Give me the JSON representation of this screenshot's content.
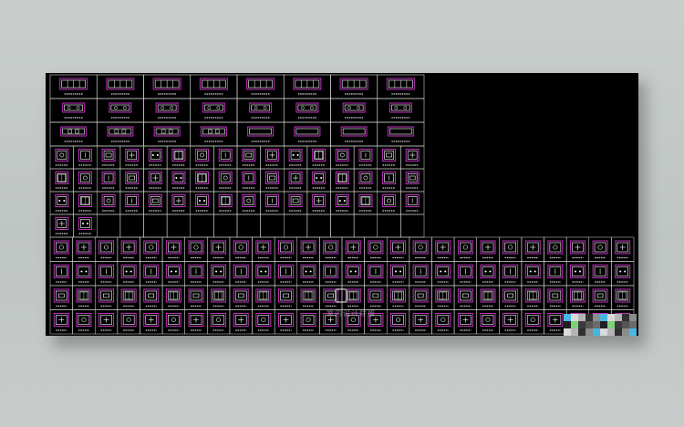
{
  "canvas": {
    "background": "#000000",
    "grid_line_color": "#d8d8d8",
    "frame_color": "#c030c0",
    "symbol_color": "#ffffff",
    "label_color": "#cfcfcf"
  },
  "upper_table": {
    "wide_rows": 3,
    "wide_cols": 8,
    "narrow_rows": 4,
    "narrow_cols": 16
  },
  "lower_table": {
    "rows": 4,
    "cols": 26
  },
  "watermark": {
    "text": "室内设计联盟",
    "icon": "watermark-logo-icon"
  }
}
